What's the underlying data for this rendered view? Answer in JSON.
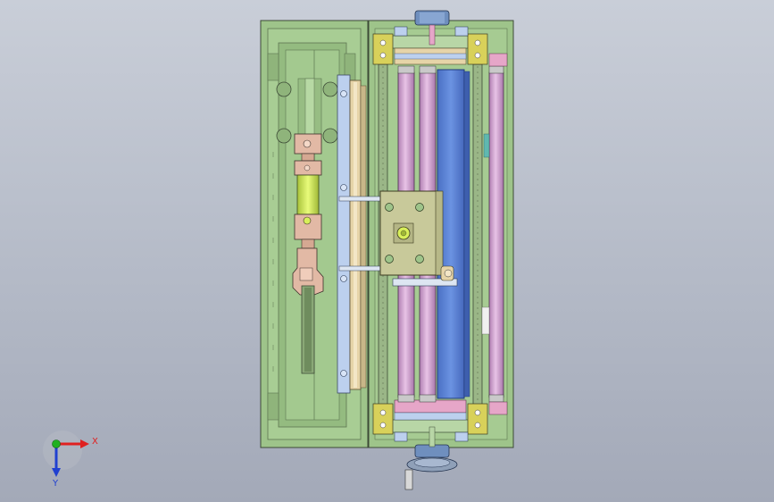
{
  "triad": {
    "x_label": "X",
    "y_label": "Y"
  },
  "colors": {
    "frame_green": "#9ec48a",
    "frame_green_dark": "#7ea76a",
    "roller_pink": "#d9a6d6",
    "belt_blue": "#5f86d8",
    "plate_olive": "#c8c99a",
    "rail_beige": "#e6d4a8",
    "side_lightblue": "#bcd0ee",
    "cylinder_yellow": "#d8ef5a",
    "clevis_tan": "#e2b9a5",
    "axis_x": "#e02020",
    "axis_y": "#2040d0",
    "axis_origin": "#20b020"
  }
}
